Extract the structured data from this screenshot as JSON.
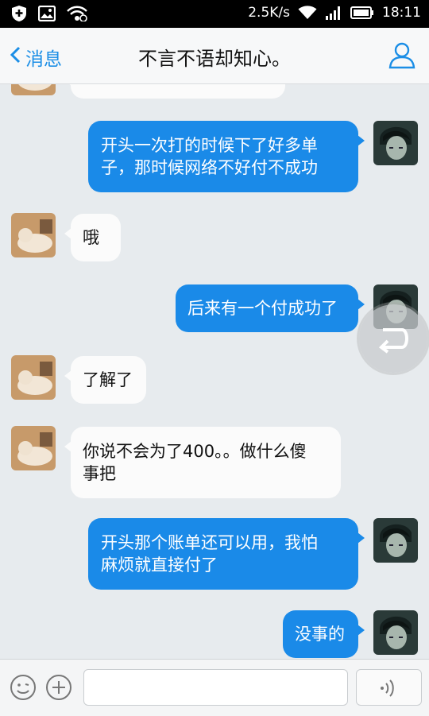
{
  "status_bar": {
    "network_speed": "2.5K/s",
    "time": "18:11"
  },
  "nav": {
    "back_label": "消息",
    "title": "不言不语却知心。"
  },
  "messages": [
    {
      "side": "other",
      "text": ""
    },
    {
      "side": "self",
      "lines": [
        "开头一次打的时候下了好多单",
        "子，那时候网络不好付不成功"
      ]
    },
    {
      "side": "other",
      "lines": [
        "哦"
      ]
    },
    {
      "side": "self",
      "lines": [
        "后来有一个付成功了"
      ]
    },
    {
      "side": "other",
      "lines": [
        "了解了"
      ]
    },
    {
      "side": "other",
      "lines": [
        "你说不会为了400。。做什么傻",
        "事把"
      ]
    },
    {
      "side": "self",
      "lines": [
        "开头那个账单还可以用，我怕",
        "麻烦就直接付了"
      ]
    },
    {
      "side": "self",
      "lines": [
        "没事的"
      ]
    }
  ],
  "input": {
    "value": "",
    "placeholder": ""
  },
  "colors": {
    "self_bubble": "#1a8ae8",
    "other_bubble": "#fbfbfb",
    "background": "#e7ebee",
    "accent": "#1b8ee6"
  }
}
